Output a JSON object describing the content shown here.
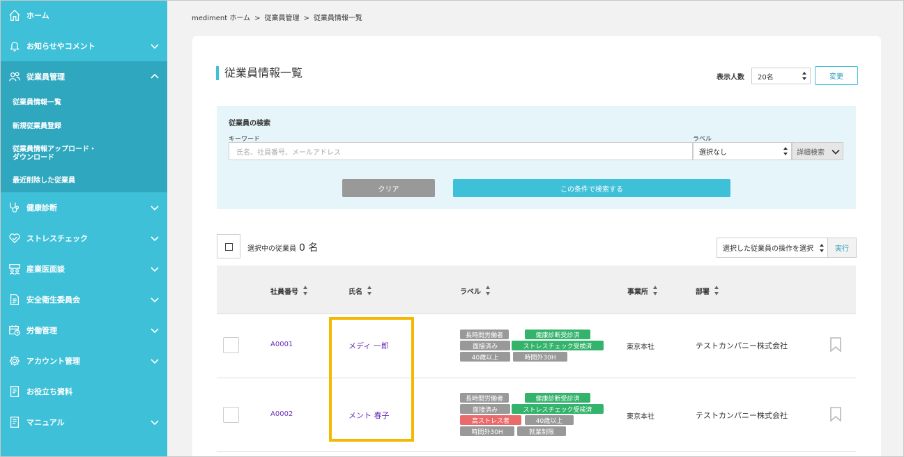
{
  "sidebar": {
    "items": [
      {
        "label": "ホーム",
        "icon": "home-icon"
      },
      {
        "label": "お知らせやコメント",
        "icon": "bell-icon"
      },
      {
        "label": "従業員管理",
        "icon": "users-icon"
      },
      {
        "label": "健康診断",
        "icon": "stethoscope-icon"
      },
      {
        "label": "ストレスチェック",
        "icon": "heart-check-icon"
      },
      {
        "label": "産業医面談",
        "icon": "meeting-icon"
      },
      {
        "label": "安全衛生委員会",
        "icon": "document-icon"
      },
      {
        "label": "労働管理",
        "icon": "calendar-clock-icon"
      },
      {
        "label": "アカウント管理",
        "icon": "gear-icon"
      },
      {
        "label": "お役立ち資料",
        "icon": "book-icon"
      },
      {
        "label": "マニュアル",
        "icon": "book-icon"
      }
    ],
    "sub_items": [
      {
        "label": "従業員情報一覧"
      },
      {
        "label": "新規従業員登録"
      },
      {
        "label": "従業員情報アップロード・"
      },
      {
        "label": "ダウンロード"
      },
      {
        "label": "最近削除した従業員"
      }
    ]
  },
  "breadcrumb": [
    "mediment ホーム",
    ">",
    "従業員管理",
    ">",
    "従業員情報一覧"
  ],
  "page": {
    "title": "従業員情報一覧",
    "display_count_label": "表示人数",
    "display_count_value": "20名",
    "change_button": "変更"
  },
  "search": {
    "title": "従業員の検索",
    "keyword_label": "キーワード",
    "keyword_placeholder": "氏名、社員番号、メールアドレス",
    "label_label": "ラベル",
    "label_value": "選択なし",
    "advanced_button": "詳細検索",
    "clear_button": "クリア",
    "submit_button": "この条件で検索する"
  },
  "selection": {
    "text": "選択中の従業員",
    "count": "0 名",
    "action_select": "選択した従業員の操作を選択",
    "exec_button": "実行"
  },
  "table": {
    "headers": [
      "社員番号",
      "氏名",
      "ラベル",
      "事業所",
      "部署"
    ],
    "rows": [
      {
        "id": "A0001",
        "name": "メディ 一郎",
        "office": "東京本社",
        "dept": "テストカンパニー株式会社",
        "tags": [
          "長時間労働者",
          "健康診断受診済",
          "面接済み",
          "ストレスチェック受検済",
          "40歳以上",
          "時間外30H"
        ]
      },
      {
        "id": "A0002",
        "name": "メント 春子",
        "office": "東京本社",
        "dept": "テストカンパニー株式会社",
        "tags": [
          "長時間労働者",
          "健康診断受診済",
          "面接済み",
          "ストレスチェック受検済",
          "高ストレス者",
          "40歳以上",
          "時間外30H",
          "就業制限"
        ]
      }
    ]
  },
  "colors": {
    "sidebar": "#3ec0d8",
    "sidebar_active": "#2fa7bf",
    "tag_gray": "#999999",
    "tag_green": "#33b36b",
    "tag_red": "#ea6b6b",
    "highlight": "#f5b800",
    "link": "#6a2fb5"
  }
}
